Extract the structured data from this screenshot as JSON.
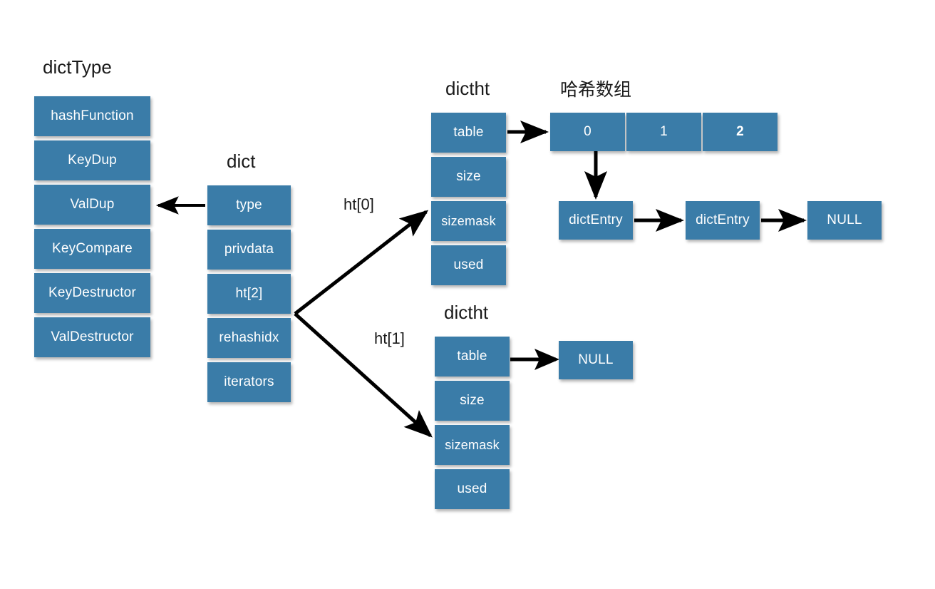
{
  "diagram": {
    "title_captions": {
      "dict_type": "dictType",
      "dict": "dict",
      "dictht_0": "dictht",
      "dictht_1": "dictht",
      "hash_array": "哈希数组"
    },
    "edge_labels": {
      "ht0": "ht[0]",
      "ht1": "ht[1]"
    },
    "dict_type_fields": [
      "hashFunction",
      "KeyDup",
      "ValDup",
      "KeyCompare",
      "KeyDestructor",
      "ValDestructor"
    ],
    "dict_fields": [
      "type",
      "privdata",
      "ht[2]",
      "rehashidx",
      "iterators"
    ],
    "dictht0_fields": [
      "table",
      "size",
      "sizemask",
      "used"
    ],
    "dictht1_fields": [
      "table",
      "size",
      "sizemask",
      "used"
    ],
    "hash_array_slots": [
      {
        "label": "0",
        "bold": false
      },
      {
        "label": "1",
        "bold": false
      },
      {
        "label": "2",
        "bold": true
      }
    ],
    "bucket_chain": [
      "dictEntry",
      "dictEntry",
      "NULL"
    ],
    "dictht1_table_target": "NULL",
    "colors": {
      "box_fill": "#3a7ca8",
      "box_text": "#ffffff",
      "arrow": "#000000",
      "caption_text": "#1a1a1a",
      "background": "#ffffff"
    }
  }
}
